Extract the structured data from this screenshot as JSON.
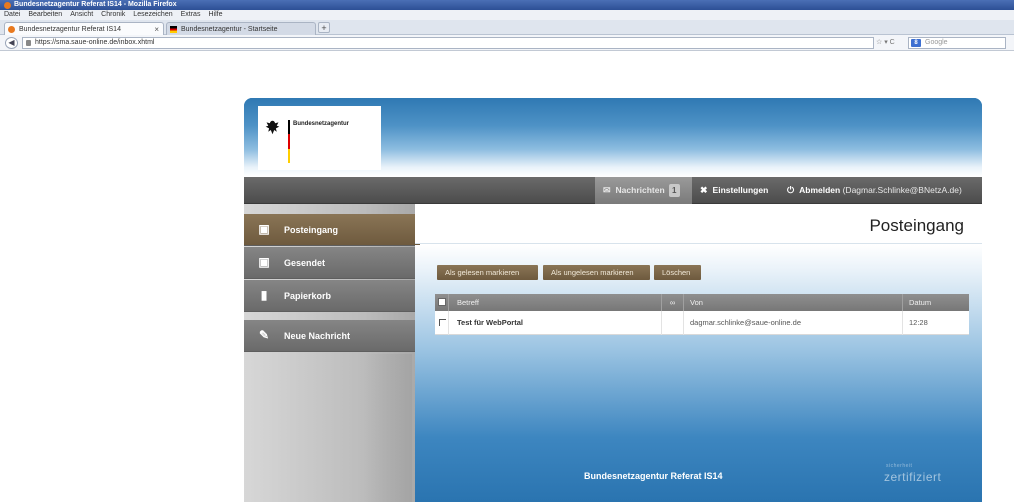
{
  "browser": {
    "window_title": "Bundesnetzagentur Referat IS14 - Mozilla Firefox",
    "menu": [
      "Datei",
      "Bearbeiten",
      "Ansicht",
      "Chronik",
      "Lesezeichen",
      "Extras",
      "Hilfe"
    ],
    "tabs": [
      {
        "label": "Bundesnetzagentur Referat IS14",
        "active": true
      },
      {
        "label": "Bundesnetzagentur - Startseite",
        "active": false
      }
    ],
    "new_tab": "+",
    "tab_close": "×",
    "url": "https://sma.saue-online.de/inbox.xhtml",
    "url_icons": "☆ ▾ C",
    "search_engine": "8",
    "search_placeholder": "Google"
  },
  "app": {
    "logo_text": "Bundesnetzagentur",
    "flag_colors": [
      "#000000",
      "#dd0000",
      "#ffce00"
    ],
    "topnav": {
      "messages_label": "Nachrichten",
      "messages_count": "1",
      "settings_label": "Einstellungen",
      "logout_label": "Abmelden",
      "logout_user": "(Dagmar.Schlinke@BNetzA.de)"
    },
    "sidebar": [
      {
        "label": "Posteingang",
        "icon": "inbox-icon",
        "active": true
      },
      {
        "label": "Gesendet",
        "icon": "outbox-icon",
        "active": false
      },
      {
        "label": "Papierkorb",
        "icon": "trash-icon",
        "active": false
      },
      {
        "label": "Neue Nachricht",
        "icon": "compose-icon",
        "active": false
      }
    ],
    "page_title": "Posteingang",
    "actions": {
      "mark_read": "Als gelesen markieren",
      "mark_unread": "Als ungelesen markieren",
      "delete": "Löschen"
    },
    "table": {
      "headers": {
        "subject": "Betreff",
        "from": "Von",
        "date": "Datum"
      },
      "rows": [
        {
          "subject": "Test für WebPortal",
          "from": "dagmar.schlinke@saue-online.de",
          "date": "12:28"
        }
      ]
    },
    "footer_text": "Bundesnetzagentur Referat IS14",
    "cert_text": "zertifiziert",
    "cert_small": "sicherheit"
  }
}
